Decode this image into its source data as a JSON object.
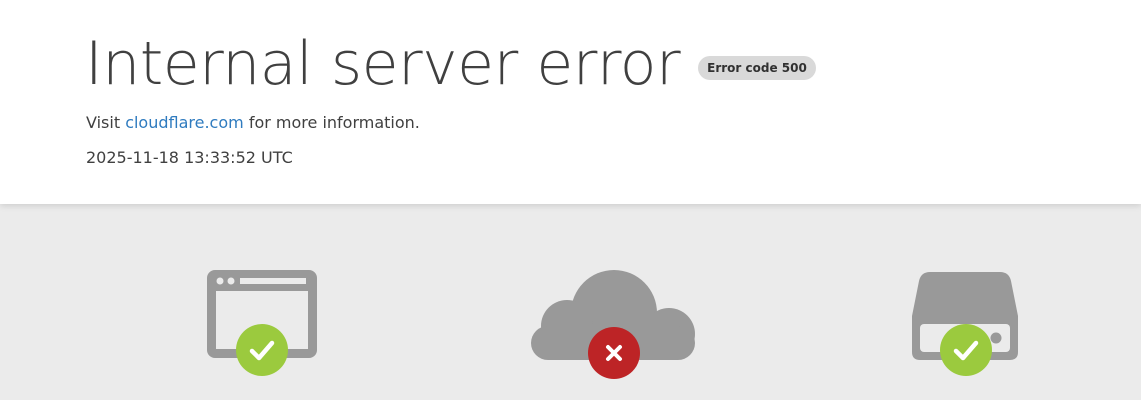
{
  "header": {
    "title": "Internal server error",
    "badge": "Error code 500",
    "info_prefix": "Visit ",
    "info_link": "cloudflare.com",
    "info_suffix": " for more information.",
    "timestamp": "2025-11-18 13:33:52 UTC"
  },
  "colors": {
    "link": "#2f7bbf",
    "ok": "#9bca3e",
    "error": "#bd2426",
    "icon_gray": "#999999",
    "band_bg": "#ebebeb"
  },
  "nodes": [
    {
      "icon": "browser-icon",
      "status": "ok"
    },
    {
      "icon": "cloud-icon",
      "status": "error"
    },
    {
      "icon": "server-icon",
      "status": "ok"
    }
  ]
}
